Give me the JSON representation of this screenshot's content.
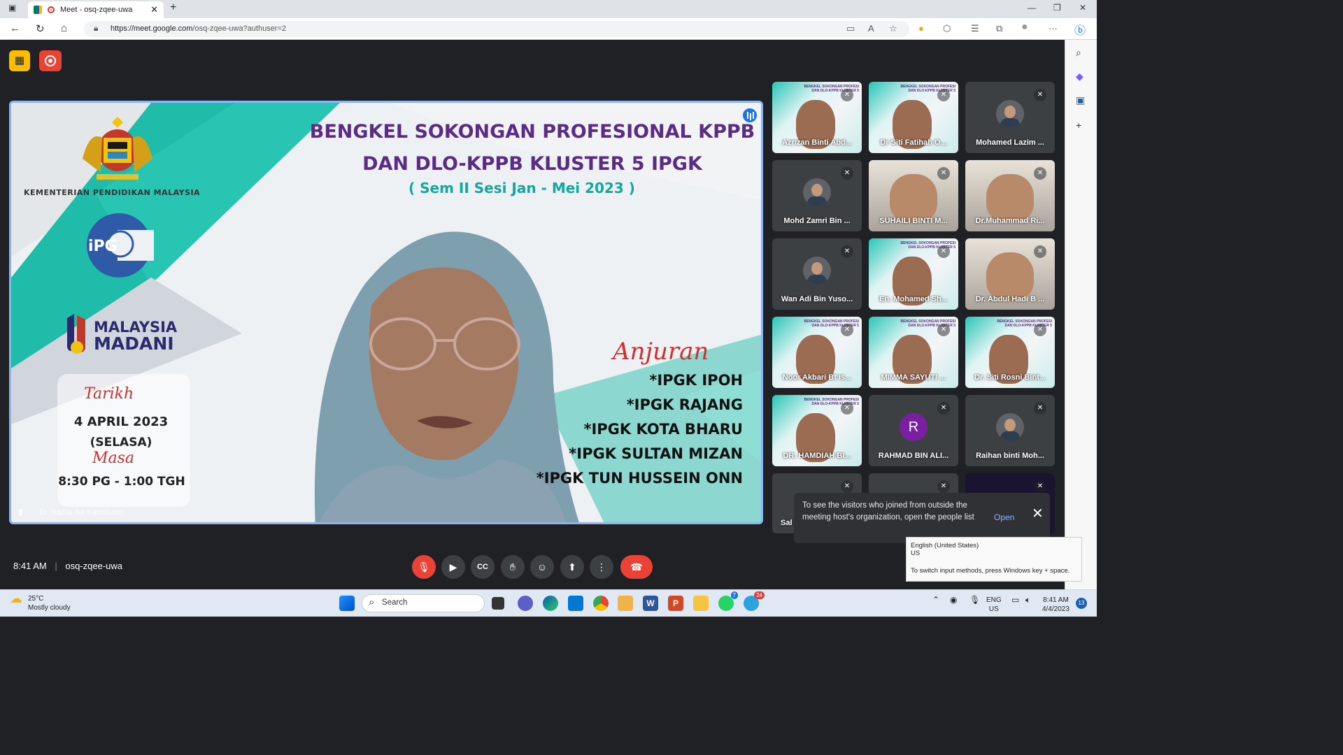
{
  "browser": {
    "tab_title": "Meet - osq-zqee-uwa",
    "url_host": "https://meet.google.com",
    "url_path": "/osq-zqee-uwa?authuser=2"
  },
  "slide": {
    "title_line1": "BENGKEL SOKONGAN PROFESIONAL KPPB",
    "title_line2": "DAN DLO-KPPB KLUSTER 5 IPGK",
    "subtitle": "( Sem II Sesi Jan - Mei 2023 )",
    "ministry": "KEMENTERIAN PENDIDIKAN MALAYSIA",
    "ipg_logo": "iPG",
    "madani_line1": "MALAYSIA",
    "madani_line2": "MADANI",
    "tarikh_label": "Tarikh",
    "date": "4 APRIL 2023",
    "day": "(SELASA)",
    "masa_label": "Masa",
    "time": "8:30 PG - 1:00 TGH",
    "anjuran_label": "Anjuran",
    "organizers": [
      "*IPGK IPOH",
      "*IPGK RAJANG",
      "*IPGK KOTA BHARU",
      "*IPGK SULTAN MIZAN",
      "*IPGK TUN HUSSEIN ONN"
    ]
  },
  "main_speaker": "Dr. Razila Aw Kamaludin",
  "participants": [
    {
      "name": "Azrizan Binti Abd...",
      "kind": "slide"
    },
    {
      "name": "Dr Siti Fatihah O...",
      "kind": "slide"
    },
    {
      "name": "Mohamed Lazim ...",
      "kind": "avatar"
    },
    {
      "name": "Mohd Zamri Bin ...",
      "kind": "avatar"
    },
    {
      "name": "SUHAILI BINTI M...",
      "kind": "cam"
    },
    {
      "name": "Dr.Muhammad Ri...",
      "kind": "cam"
    },
    {
      "name": "Wan Adi Bin Yuso...",
      "kind": "avatar"
    },
    {
      "name": "En. Mohamed Sh...",
      "kind": "slide"
    },
    {
      "name": "Dr. Abdul Hadi B ...",
      "kind": "cam"
    },
    {
      "name": "Noor Akbari Bt Is...",
      "kind": "slide"
    },
    {
      "name": "MIMMA SAYUTI ...",
      "kind": "slide"
    },
    {
      "name": "Dr. Siti Rosni Bint...",
      "kind": "slide"
    },
    {
      "name": "DR. HAMDIAH BI...",
      "kind": "slide"
    },
    {
      "name": "RAHMAD BIN ALI...",
      "kind": "letter",
      "letter": "R"
    },
    {
      "name": "Raihan binti Moh...",
      "kind": "avatar"
    },
    {
      "name": "Sal",
      "kind": "plain"
    },
    {
      "name": "",
      "kind": "plain"
    },
    {
      "name": "",
      "kind": "dark"
    }
  ],
  "notice": {
    "text": "To see the visitors who joined from outside the meeting host's organization, open the people list",
    "open_label": "Open"
  },
  "ime_tip": {
    "language": "English (United States)",
    "layout": "US",
    "hint": "To switch input methods, press Windows key + space."
  },
  "meeting": {
    "time": "8:41 AM",
    "code": "osq-zqee-uwa"
  },
  "taskbar": {
    "temp": "25°C",
    "weather": "Mostly cloudy",
    "search_placeholder": "Search",
    "lang": "ENG",
    "region": "US",
    "clock_time": "8:41 AM",
    "clock_date": "4/4/2023",
    "notif_count": "13",
    "whatsapp_badge": "7",
    "telegram_badge": "24"
  },
  "colors": {
    "accent": "#8ab4f8",
    "end_call": "#ea4335",
    "slide_title": "#5b2c83",
    "slide_sub": "#13a89e"
  }
}
